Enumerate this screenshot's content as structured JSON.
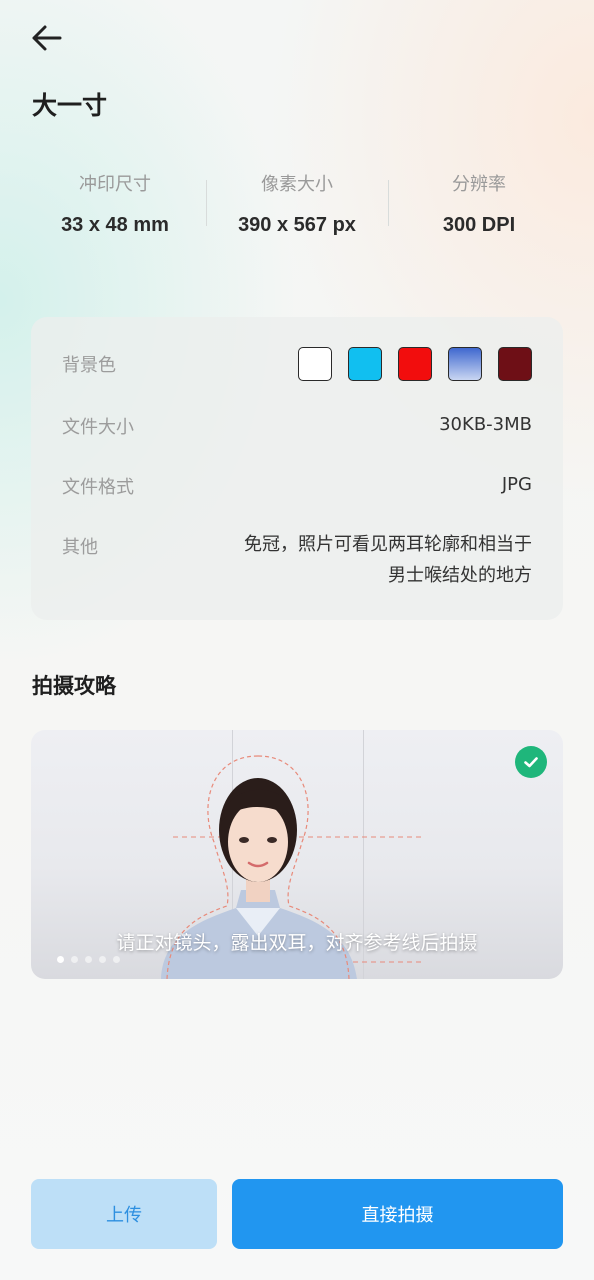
{
  "header": {
    "title": "大一寸"
  },
  "specs": [
    {
      "label": "冲印尺寸",
      "value": "33 x 48 mm"
    },
    {
      "label": "像素大小",
      "value": "390 x 567 px"
    },
    {
      "label": "分辨率",
      "value": "300 DPI"
    }
  ],
  "details": {
    "background": {
      "label": "背景色",
      "colors": [
        "#ffffff",
        "#11bff0",
        "#f20d0d",
        "#5d82d8",
        "#6e0f16"
      ]
    },
    "file_size": {
      "label": "文件大小",
      "value": "30KB-3MB"
    },
    "file_format": {
      "label": "文件格式",
      "value": "JPG"
    },
    "other": {
      "label": "其他",
      "value_line1": "免冠，照片可看见两耳轮廓和相当于",
      "value_line2": "男士喉结处的地方"
    }
  },
  "guide": {
    "title": "拍摄攻略",
    "caption": "请正对镜头，露出双耳，对齐参考线后拍摄",
    "slides": 5,
    "active_slide": 1
  },
  "actions": {
    "upload": "上传",
    "shoot": "直接拍摄"
  },
  "colors": {
    "primary": "#2196f0",
    "primary_light": "#bddff7",
    "check": "#1fb67b"
  }
}
